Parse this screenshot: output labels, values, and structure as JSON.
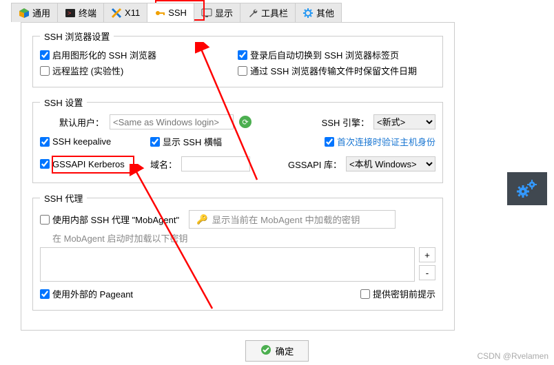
{
  "tabs": {
    "general": "通用",
    "terminal": "终端",
    "x11": "X11",
    "ssh": "SSH",
    "display": "显示",
    "toolbar": "工具栏",
    "other": "其他"
  },
  "browser": {
    "legend": "SSH 浏览器设置",
    "graphical": "启用图形化的 SSH 浏览器",
    "remote_monitor": "远程监控 (实验性)",
    "auto_switch": "登录后自动切换到 SSH 浏览器标签页",
    "preserve_date": "通过 SSH 浏览器传输文件时保留文件日期"
  },
  "settings": {
    "legend": "SSH 设置",
    "default_user_label": "默认用户：",
    "default_user_placeholder": "<Same as Windows login>",
    "keepalive": "SSH keepalive",
    "show_banner": "显示 SSH 横幅",
    "verify_host": "首次连接时验证主机身份",
    "gssapi": "GSSAPI Kerberos",
    "domain_label": "域名：",
    "engine_label": "SSH 引擎：",
    "engine_value": "<新式>",
    "gssapi_lib_label": "GSSAPI 库：",
    "gssapi_lib_value": "<本机 Windows>"
  },
  "proxy": {
    "legend": "SSH 代理",
    "internal": "使用内部 SSH 代理 \"MobAgent\"",
    "key_placeholder": "显示当前在 MobAgent 中加载的密钥",
    "startup_note": "在 MobAgent 启动时加载以下密钥",
    "external": "使用外部的 Pageant",
    "prompt_key": "提供密钥前提示",
    "add": "+",
    "del": "-"
  },
  "confirm": "确定",
  "footer": "CSDN @Rvelamen"
}
